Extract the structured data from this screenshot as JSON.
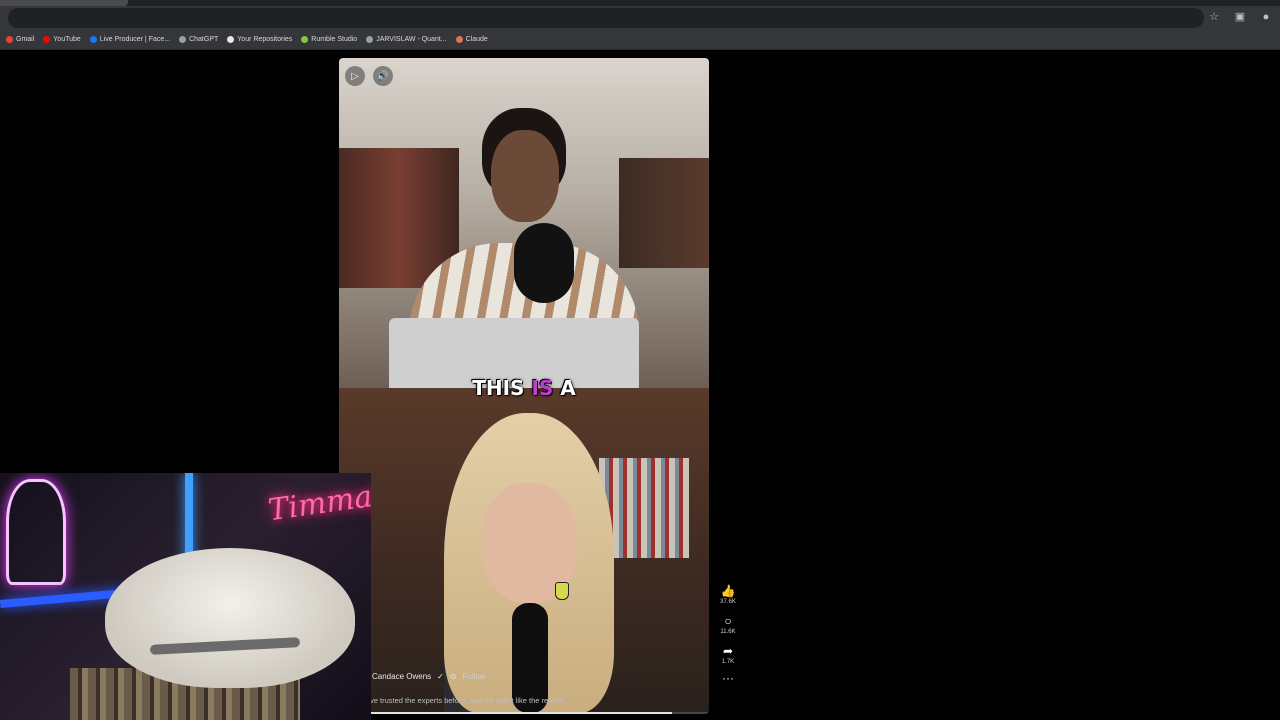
{
  "bookmarks": [
    {
      "label": "Gmail",
      "color": "#ea4335"
    },
    {
      "label": "YouTube",
      "color": "#ff0000"
    },
    {
      "label": "Live Producer | Face...",
      "color": "#1877f2"
    },
    {
      "label": "ChatGPT",
      "color": "#9aa0a6"
    },
    {
      "label": "Your Repositories",
      "color": "#e6e6e6"
    },
    {
      "label": "Rumble Studio",
      "color": "#85c742"
    },
    {
      "label": "JARVISLAW - Quant...",
      "color": "#9aa0a6"
    },
    {
      "label": "Claude",
      "color": "#d97757"
    }
  ],
  "video": {
    "caption_pre": "THIS ",
    "caption_highlight": "IS",
    "caption_post": " A",
    "highlight_color": "#c23bd6",
    "channel_name": "Candace Owens",
    "follow_label": "Follow",
    "subtitle": "ve trusted the experts before, and we didn't like the results.",
    "progress": 0.9
  },
  "actions": {
    "likes": "37.6K",
    "comments": "11.6K",
    "shares": "1.7K"
  },
  "webcam": {
    "neon_sign": "Timmay"
  }
}
